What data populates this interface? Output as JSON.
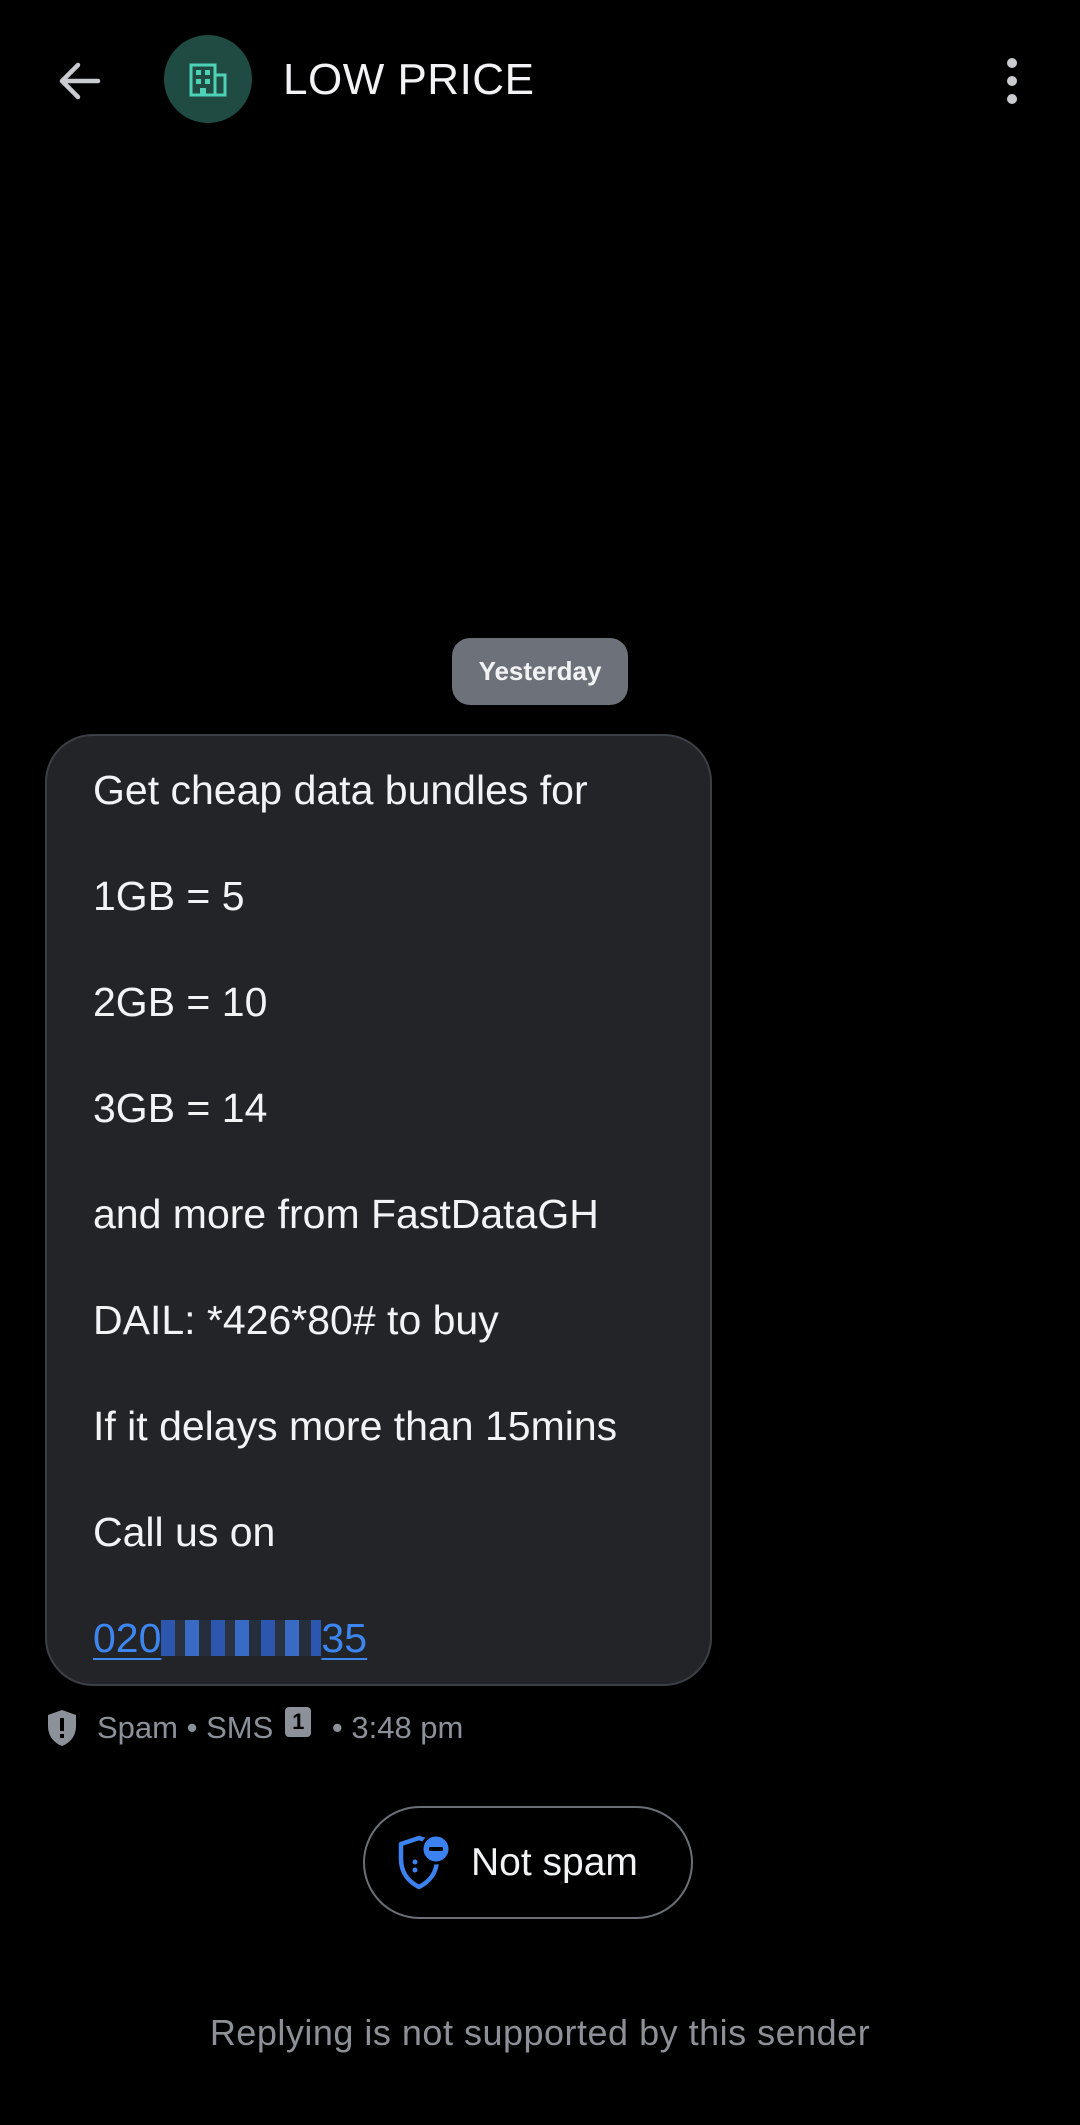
{
  "header": {
    "title": "LOW PRICE",
    "back_icon": "arrow-left-icon",
    "avatar_icon": "building-icon",
    "menu_icon": "more-vertical-icon"
  },
  "date_chip": "Yesterday",
  "message": {
    "lines": [
      "Get cheap data bundles for",
      "1GB = 5",
      "2GB = 10",
      "3GB = 14",
      "and more from FastDataGH",
      "DAIL:  *426*80# to buy",
      "If it delays more than 15mins",
      "Call us on"
    ],
    "phone_prefix": "020",
    "phone_suffix": "35"
  },
  "meta": {
    "status": "Spam",
    "separator": " • ",
    "type": "SMS",
    "sim": "1",
    "time": "3:48 pm"
  },
  "not_spam_button": {
    "label": "Not spam"
  },
  "footer": "Replying is not supported by this sender",
  "colors": {
    "link": "#3d86ef",
    "avatar_bg": "#1f4b43",
    "avatar_fg": "#4fd1b5",
    "bubble_bg": "#222428"
  }
}
